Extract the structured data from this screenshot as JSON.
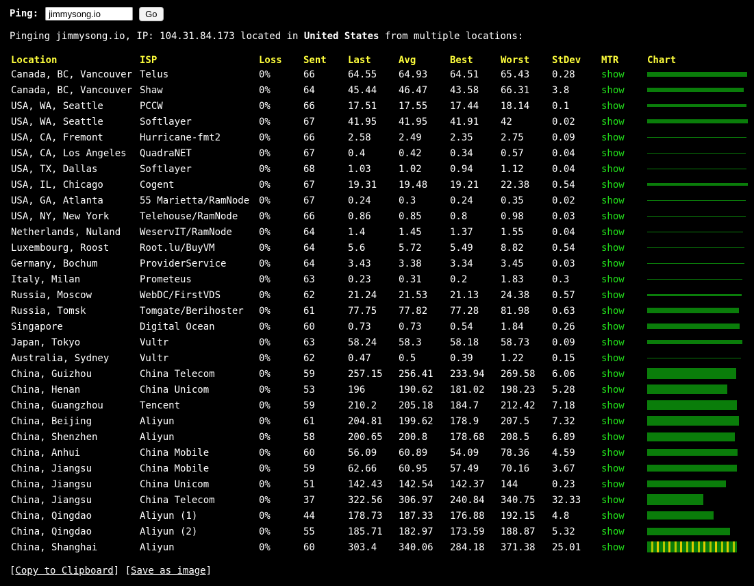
{
  "header": {
    "ping_label": "Ping:",
    "input_value": "jimmysong.io",
    "go_label": "Go"
  },
  "info": {
    "prefix": "Pinging jimmysong.io, IP: 104.31.84.173 located in",
    "country": "United States",
    "suffix": "from multiple locations:"
  },
  "columns": [
    "Location",
    "ISP",
    "Loss",
    "Sent",
    "Last",
    "Avg",
    "Best",
    "Worst",
    "StDev",
    "MTR",
    "Chart"
  ],
  "rows": [
    {
      "location": "Canada, BC, Vancouver",
      "isp": "Telus",
      "loss": "0%",
      "sent": "66",
      "last": "64.55",
      "avg": "64.93",
      "best": "64.51",
      "worst": "65.43",
      "stdev": "0.28",
      "mtr": "show"
    },
    {
      "location": "Canada, BC, Vancouver",
      "isp": "Shaw",
      "loss": "0%",
      "sent": "64",
      "last": "45.44",
      "avg": "46.47",
      "best": "43.58",
      "worst": "66.31",
      "stdev": "3.8",
      "mtr": "show"
    },
    {
      "location": "USA, WA, Seattle",
      "isp": "PCCW",
      "loss": "0%",
      "sent": "66",
      "last": "17.51",
      "avg": "17.55",
      "best": "17.44",
      "worst": "18.14",
      "stdev": "0.1",
      "mtr": "show"
    },
    {
      "location": "USA, WA, Seattle",
      "isp": "Softlayer",
      "loss": "0%",
      "sent": "67",
      "last": "41.95",
      "avg": "41.95",
      "best": "41.91",
      "worst": "42",
      "stdev": "0.02",
      "mtr": "show"
    },
    {
      "location": "USA, CA, Fremont",
      "isp": "Hurricane-fmt2",
      "loss": "0%",
      "sent": "66",
      "last": "2.58",
      "avg": "2.49",
      "best": "2.35",
      "worst": "2.75",
      "stdev": "0.09",
      "mtr": "show"
    },
    {
      "location": "USA, CA, Los Angeles",
      "isp": "QuadraNET",
      "loss": "0%",
      "sent": "67",
      "last": "0.4",
      "avg": "0.42",
      "best": "0.34",
      "worst": "0.57",
      "stdev": "0.04",
      "mtr": "show"
    },
    {
      "location": "USA, TX, Dallas",
      "isp": "Softlayer",
      "loss": "0%",
      "sent": "68",
      "last": "1.03",
      "avg": "1.02",
      "best": "0.94",
      "worst": "1.12",
      "stdev": "0.04",
      "mtr": "show"
    },
    {
      "location": "USA, IL, Chicago",
      "isp": "Cogent",
      "loss": "0%",
      "sent": "67",
      "last": "19.31",
      "avg": "19.48",
      "best": "19.21",
      "worst": "22.38",
      "stdev": "0.54",
      "mtr": "show"
    },
    {
      "location": "USA, GA, Atlanta",
      "isp": "55 Marietta/RamNode",
      "loss": "0%",
      "sent": "67",
      "last": "0.24",
      "avg": "0.3",
      "best": "0.24",
      "worst": "0.35",
      "stdev": "0.02",
      "mtr": "show"
    },
    {
      "location": "USA, NY, New York",
      "isp": "Telehouse/RamNode",
      "loss": "0%",
      "sent": "66",
      "last": "0.86",
      "avg": "0.85",
      "best": "0.8",
      "worst": "0.98",
      "stdev": "0.03",
      "mtr": "show"
    },
    {
      "location": "Netherlands, Nuland",
      "isp": "WeservIT/RamNode",
      "loss": "0%",
      "sent": "64",
      "last": "1.4",
      "avg": "1.45",
      "best": "1.37",
      "worst": "1.55",
      "stdev": "0.04",
      "mtr": "show"
    },
    {
      "location": "Luxembourg, Roost",
      "isp": "Root.lu/BuyVM",
      "loss": "0%",
      "sent": "64",
      "last": "5.6",
      "avg": "5.72",
      "best": "5.49",
      "worst": "8.82",
      "stdev": "0.54",
      "mtr": "show"
    },
    {
      "location": "Germany, Bochum",
      "isp": "ProviderService",
      "loss": "0%",
      "sent": "64",
      "last": "3.43",
      "avg": "3.38",
      "best": "3.34",
      "worst": "3.45",
      "stdev": "0.03",
      "mtr": "show"
    },
    {
      "location": "Italy, Milan",
      "isp": "Prometeus",
      "loss": "0%",
      "sent": "63",
      "last": "0.23",
      "avg": "0.31",
      "best": "0.2",
      "worst": "1.83",
      "stdev": "0.3",
      "mtr": "show"
    },
    {
      "location": "Russia, Moscow",
      "isp": "WebDC/FirstVDS",
      "loss": "0%",
      "sent": "62",
      "last": "21.24",
      "avg": "21.53",
      "best": "21.13",
      "worst": "24.38",
      "stdev": "0.57",
      "mtr": "show"
    },
    {
      "location": "Russia, Tomsk",
      "isp": "Tomgate/Berihoster",
      "loss": "0%",
      "sent": "61",
      "last": "77.75",
      "avg": "77.82",
      "best": "77.28",
      "worst": "81.98",
      "stdev": "0.63",
      "mtr": "show"
    },
    {
      "location": "Singapore",
      "isp": "Digital Ocean",
      "loss": "0%",
      "sent": "60",
      "last": "0.73",
      "avg": "0.73",
      "best": "0.54",
      "worst": "1.84",
      "stdev": "0.26",
      "mtr": "show"
    },
    {
      "location": "Japan, Tokyo",
      "isp": "Vultr",
      "loss": "0%",
      "sent": "63",
      "last": "58.24",
      "avg": "58.3",
      "best": "58.18",
      "worst": "58.73",
      "stdev": "0.09",
      "mtr": "show"
    },
    {
      "location": "Australia, Sydney",
      "isp": "Vultr",
      "loss": "0%",
      "sent": "62",
      "last": "0.47",
      "avg": "0.5",
      "best": "0.39",
      "worst": "1.22",
      "stdev": "0.15",
      "mtr": "show"
    },
    {
      "location": "China, Guizhou",
      "isp": "China Telecom",
      "loss": "0%",
      "sent": "59",
      "last": "257.15",
      "avg": "256.41",
      "best": "233.94",
      "worst": "269.58",
      "stdev": "6.06",
      "mtr": "show"
    },
    {
      "location": "China, Henan",
      "isp": "China Unicom",
      "loss": "0%",
      "sent": "53",
      "last": "196",
      "avg": "190.62",
      "best": "181.02",
      "worst": "198.23",
      "stdev": "5.28",
      "mtr": "show"
    },
    {
      "location": "China, Guangzhou",
      "isp": "Tencent",
      "loss": "0%",
      "sent": "59",
      "last": "210.2",
      "avg": "205.18",
      "best": "184.7",
      "worst": "212.42",
      "stdev": "7.18",
      "mtr": "show"
    },
    {
      "location": "China, Beijing",
      "isp": "Aliyun",
      "loss": "0%",
      "sent": "61",
      "last": "204.81",
      "avg": "199.62",
      "best": "178.9",
      "worst": "207.5",
      "stdev": "7.32",
      "mtr": "show"
    },
    {
      "location": "China, Shenzhen",
      "isp": "Aliyun",
      "loss": "0%",
      "sent": "58",
      "last": "200.65",
      "avg": "200.8",
      "best": "178.68",
      "worst": "208.5",
      "stdev": "6.89",
      "mtr": "show"
    },
    {
      "location": "China, Anhui",
      "isp": "China Mobile",
      "loss": "0%",
      "sent": "60",
      "last": "56.09",
      "avg": "60.89",
      "best": "54.09",
      "worst": "78.36",
      "stdev": "4.59",
      "mtr": "show"
    },
    {
      "location": "China, Jiangsu",
      "isp": "China Mobile",
      "loss": "0%",
      "sent": "59",
      "last": "62.66",
      "avg": "60.95",
      "best": "57.49",
      "worst": "70.16",
      "stdev": "3.67",
      "mtr": "show"
    },
    {
      "location": "China, Jiangsu",
      "isp": "China Unicom",
      "loss": "0%",
      "sent": "51",
      "last": "142.43",
      "avg": "142.54",
      "best": "142.37",
      "worst": "144",
      "stdev": "0.23",
      "mtr": "show"
    },
    {
      "location": "China, Jiangsu",
      "isp": "China Telecom",
      "loss": "0%",
      "sent": "37",
      "last": "322.56",
      "avg": "306.97",
      "best": "240.84",
      "worst": "340.75",
      "stdev": "32.33",
      "mtr": "show"
    },
    {
      "location": "China, Qingdao",
      "isp": "Aliyun (1)",
      "loss": "0%",
      "sent": "44",
      "last": "178.73",
      "avg": "187.33",
      "best": "176.88",
      "worst": "192.15",
      "stdev": "4.8",
      "mtr": "show"
    },
    {
      "location": "China, Qingdao",
      "isp": "Aliyun (2)",
      "loss": "0%",
      "sent": "55",
      "last": "185.71",
      "avg": "182.97",
      "best": "173.59",
      "worst": "188.87",
      "stdev": "5.32",
      "mtr": "show"
    },
    {
      "location": "China, Shanghai",
      "isp": "Aliyun",
      "loss": "0%",
      "sent": "60",
      "last": "303.4",
      "avg": "340.06",
      "best": "284.18",
      "worst": "371.38",
      "stdev": "25.01",
      "mtr": "show"
    }
  ],
  "footer": {
    "copy_label": "Copy to Clipboard",
    "save_label": "Save as image"
  },
  "colors": {
    "header": "#ffff3c",
    "link": "#22e01a",
    "bar": "#0a7d0a"
  }
}
